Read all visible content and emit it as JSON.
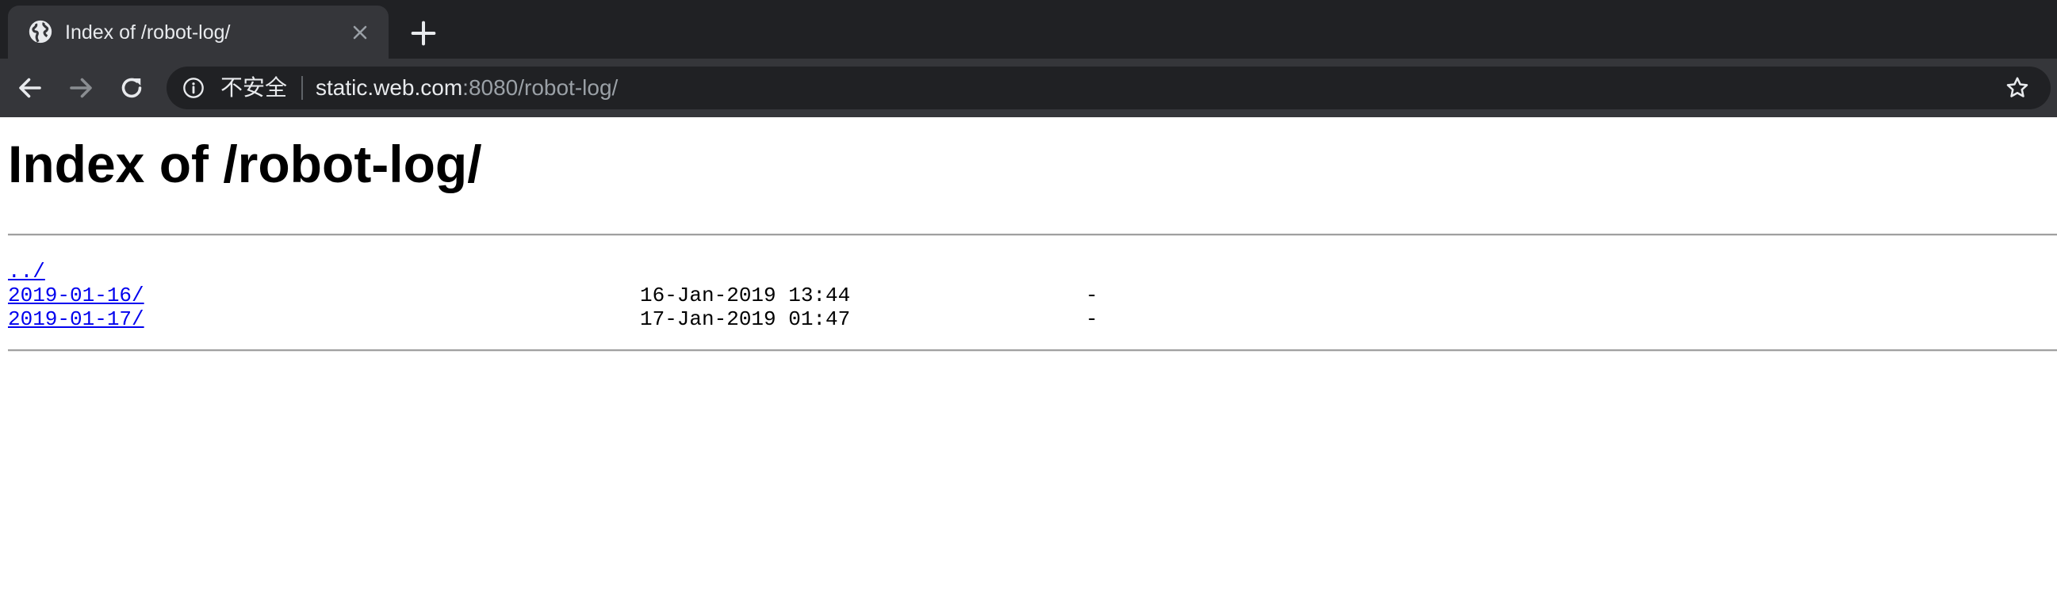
{
  "browser": {
    "tab": {
      "title": "Index of /robot-log/"
    },
    "address_bar": {
      "security_label": "不安全",
      "url_host": "static.web.com",
      "url_rest": ":8080/robot-log/"
    }
  },
  "page": {
    "heading": "Index of /robot-log/",
    "entries": [
      {
        "name": "../",
        "date": "",
        "size": ""
      },
      {
        "name": "2019-01-16/",
        "date": "16-Jan-2019 13:44",
        "size": "-"
      },
      {
        "name": "2019-01-17/",
        "date": "17-Jan-2019 01:47",
        "size": "-"
      }
    ]
  },
  "colors": {
    "tabstrip_bg": "#202124",
    "toolbar_bg": "#35363a",
    "link": "#0000ee"
  }
}
